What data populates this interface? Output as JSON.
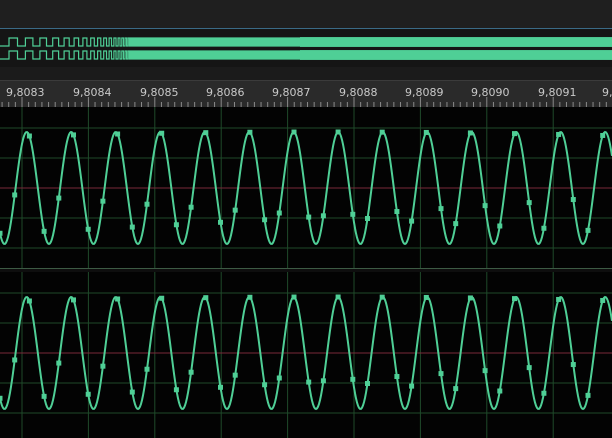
{
  "timeline": {
    "tick_labels": [
      "9,8083",
      "9,8084",
      "9,8085",
      "9,8086",
      "9,8087",
      "9,8088",
      "9,8089",
      "9,8090",
      "9,8091",
      "9,"
    ]
  },
  "channels": [
    {
      "name": "waveform-channel-1"
    },
    {
      "name": "waveform-channel-2"
    }
  ],
  "colors": {
    "waveform": "#4fcf96",
    "zero_line": "#7a2a3a",
    "grid": "#1f4a2a",
    "ruler_bg": "#2a2a2a",
    "overview_bg": "#151515",
    "topbar_border": "#3a6a86"
  }
}
